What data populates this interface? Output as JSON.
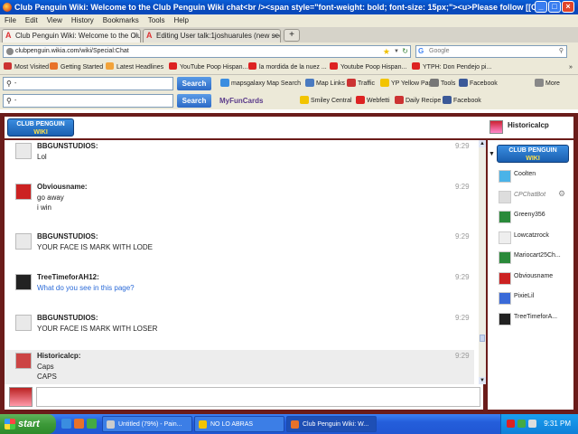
{
  "window": {
    "title": "Club Penguin Wiki: Welcome to the Club Penguin Wiki chat<br /><span style=\"font-weight: bold; font-size: 15px;\"><u>Please follow [[Club Pengui...",
    "controls": [
      "_",
      "□",
      "×"
    ]
  },
  "menu": [
    "File",
    "Edit",
    "View",
    "History",
    "Bookmarks",
    "Tools",
    "Help"
  ],
  "tabs": [
    {
      "label": "Club Penguin Wiki: Welcome to the Club ...",
      "active": true
    },
    {
      "label": "Editing User talk:1joshuarules (new secti...",
      "active": false
    }
  ],
  "newtab_label": "+",
  "nav": {
    "url": "clubpenguin.wikia.com/wiki/Special:Chat",
    "search_placeholder": "Google"
  },
  "bookmarks": [
    {
      "label": "Most Visited",
      "color": "#c33"
    },
    {
      "label": "Getting Started",
      "color": "#e8722a"
    },
    {
      "label": "Latest Headlines",
      "color": "#f2a33a"
    },
    {
      "label": "YouTube Poop Hispan...",
      "color": "#d22"
    },
    {
      "label": "la mordida de la nuez ...",
      "color": "#d22"
    },
    {
      "label": "Youtube Poop Hispan...",
      "color": "#d22"
    },
    {
      "label": "YTPH: Don Pendejo pi...",
      "color": "#d22"
    }
  ],
  "toolbar1": {
    "search_value": "-",
    "button": "Search",
    "items": [
      {
        "label": "mapsgalaxy Map Search",
        "color": "#3a8de0"
      },
      {
        "label": "Map Links",
        "color": "#4a7ac0"
      },
      {
        "label": "Traffic",
        "color": "#c33"
      },
      {
        "label": "YP Yellow Pages",
        "color": "#f2c400"
      },
      {
        "label": "Tools",
        "color": "#777"
      },
      {
        "label": "Facebook",
        "color": "#3b5998"
      },
      {
        "label": "More",
        "color": "#888"
      }
    ]
  },
  "toolbar2": {
    "search_value": "-",
    "button": "Search",
    "brand": "MyFunCards",
    "items": [
      {
        "label": "Smiley Central",
        "color": "#f2c400"
      },
      {
        "label": "Webfetti",
        "color": "#d22"
      },
      {
        "label": "Daily Recipe",
        "color": "#c33"
      },
      {
        "label": "Facebook",
        "color": "#3b5998"
      }
    ]
  },
  "chat": {
    "logo": {
      "line1": "CLUB PENGUIN",
      "line2": "WIKI"
    },
    "current_user": "Historicalcp",
    "messages": [
      {
        "user": "BBGUNSTUDIOS:",
        "lines": [
          "Lol"
        ],
        "time": "9:29",
        "avatar_color": "#e9e9e9",
        "highlight": false,
        "link": false
      },
      {
        "user": "Obviousname:",
        "lines": [
          "go away",
          "i win"
        ],
        "time": "9:29",
        "avatar_color": "#c22",
        "highlight": false,
        "link": false
      },
      {
        "user": "BBGUNSTUDIOS:",
        "lines": [
          "YOUR FACE IS MARK WITH LODE"
        ],
        "time": "9:29",
        "avatar_color": "#e9e9e9",
        "highlight": false,
        "link": false
      },
      {
        "user": "TreeTimeforAH12:",
        "lines": [
          "What do you see in this page?"
        ],
        "time": "9:29",
        "avatar_color": "#222",
        "highlight": false,
        "link": true
      },
      {
        "user": "BBGUNSTUDIOS:",
        "lines": [
          "YOUR FACE IS MARK WITH LOSER"
        ],
        "time": "9:29",
        "avatar_color": "#e9e9e9",
        "highlight": false,
        "link": false
      },
      {
        "user": "Historicalcp:",
        "lines": [
          "Caps",
          "CAPS"
        ],
        "time": "9:29",
        "avatar_color": "#c44",
        "highlight": true,
        "link": false
      }
    ],
    "users": [
      {
        "name": "Coolten",
        "color": "#4ab3e8",
        "italic": false
      },
      {
        "name": "CPChatBot",
        "color": "#ddd",
        "italic": true
      },
      {
        "name": "Greeny356",
        "color": "#2a8a3a",
        "italic": false
      },
      {
        "name": "Lowcatzrock",
        "color": "#eee",
        "italic": false
      },
      {
        "name": "Mariocart25Ch...",
        "color": "#2a8a3a",
        "italic": false
      },
      {
        "name": "Obviousname",
        "color": "#c22",
        "italic": false
      },
      {
        "name": "PixieLil",
        "color": "#3a6ad8",
        "italic": false
      },
      {
        "name": "TreeTimeforA...",
        "color": "#222",
        "italic": false
      }
    ]
  },
  "taskbar": {
    "start": "start",
    "quicklaunch": [
      {
        "color": "#3a8de0"
      },
      {
        "color": "#e8722a"
      },
      {
        "color": "#4a4"
      }
    ],
    "tasks": [
      {
        "label": "Untitled (79%) - Pain...",
        "color": "#ccc",
        "active": false
      },
      {
        "label": "NO LO ABRAS",
        "color": "#f2c400",
        "active": false
      },
      {
        "label": "Club Penguin Wiki: W...",
        "color": "#e8722a",
        "active": true
      }
    ],
    "tray_icons": [
      {
        "color": "#d22"
      },
      {
        "color": "#4a4"
      },
      {
        "color": "#ddd"
      }
    ],
    "clock": "9:31 PM"
  }
}
